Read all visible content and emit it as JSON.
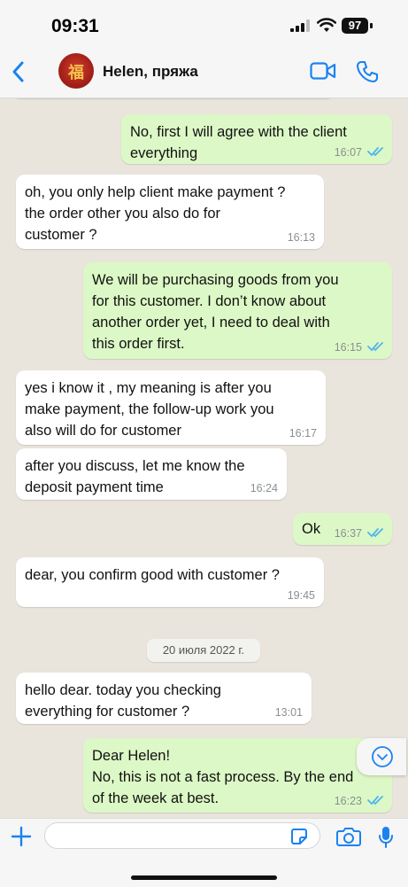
{
  "status_bar": {
    "time": "09:31",
    "battery": "97"
  },
  "header": {
    "contact_name": "Helen, пряжа"
  },
  "chat": {
    "date_separator": "20 июля 2022 г.",
    "messages": [
      {
        "direction": "out",
        "text": "No, first I will agree with the client\neverything",
        "time": "16:07",
        "read": true
      },
      {
        "direction": "in",
        "text": "oh, you only help client make payment ?\nthe order other you also do for\ncustomer ?",
        "time": "16:13"
      },
      {
        "direction": "out",
        "text": "We will be purchasing goods from you\nfor this customer. I don’t know about\nanother order yet, I need to deal with\nthis order first.",
        "time": "16:15",
        "read": true
      },
      {
        "direction": "in",
        "text": "yes i know it , my meaning is after you\nmake payment, the follow-up work you\nalso will do for customer",
        "time": "16:17"
      },
      {
        "direction": "in",
        "text": "after you discuss, let me know the\ndeposit payment time",
        "time": "16:24"
      },
      {
        "direction": "out",
        "text": "Ok",
        "time": "16:37",
        "read": true
      },
      {
        "direction": "in",
        "text": "dear, you confirm good with customer ?",
        "time": "19:45"
      },
      {
        "direction": "in",
        "text": "hello dear. today you checking\neverything for customer ?",
        "time": "13:01"
      },
      {
        "direction": "out",
        "text": "Dear Helen!\nNo, this is not a fast process. By the end\nof the week at best.",
        "time": "16:23",
        "read": true
      }
    ]
  },
  "input": {
    "value": "",
    "placeholder": ""
  },
  "colors": {
    "accent": "#1a82f0",
    "outgoing_bubble": "#dcf8c6",
    "incoming_bubble": "#ffffff",
    "read_ticks": "#4fb6ec"
  }
}
